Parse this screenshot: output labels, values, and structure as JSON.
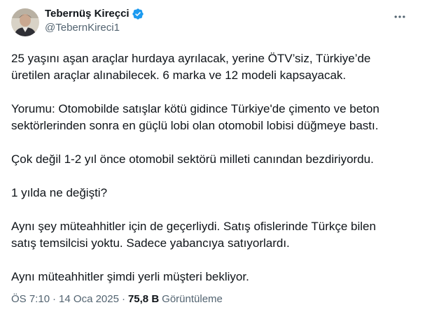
{
  "author": {
    "display_name": "Tebernüş Kireçci",
    "handle": "@TebernKireci1",
    "avatar_icon": "person-avatar-icon",
    "verified_icon": "verified-badge-icon",
    "verified_color": "#1d9bf0"
  },
  "more_icon": "more-horizontal-icon",
  "paragraphs": [
    "25 yaşını aşan araçlar hurdaya ayrılacak, yerine ÖTV’siz, Türkiye’de\nüretilen araçlar alınabilecek. 6 marka ve 12 modeli kapsayacak.",
    "Yorumu: Otomobilde satışlar kötü gidince Türkiye'de çimento ve beton\nsektörlerinden sonra en güçlü lobi olan otomobil lobisi düğmeye bastı.",
    "Çok değil 1-2 yıl önce otomobil sektörü milleti canından bezdiriyordu.",
    "1 yılda ne değişti?",
    "Aynı şey müteahhitler için de geçerliydi. Satış ofislerinde Türkçe bilen\nsatış temsilcisi yoktu. Sadece yabancıya satıyorlardı.",
    "Aynı müteahhitler şimdi yerli müşteri bekliyor."
  ],
  "meta": {
    "time": "ÖS 7:10",
    "separator": "·",
    "date": "14 Oca 2025",
    "views_count": "75,8 B",
    "views_label": "Görüntüleme"
  },
  "colors": {
    "text_primary": "#0f1419",
    "text_secondary": "#536471",
    "accent": "#1d9bf0"
  }
}
